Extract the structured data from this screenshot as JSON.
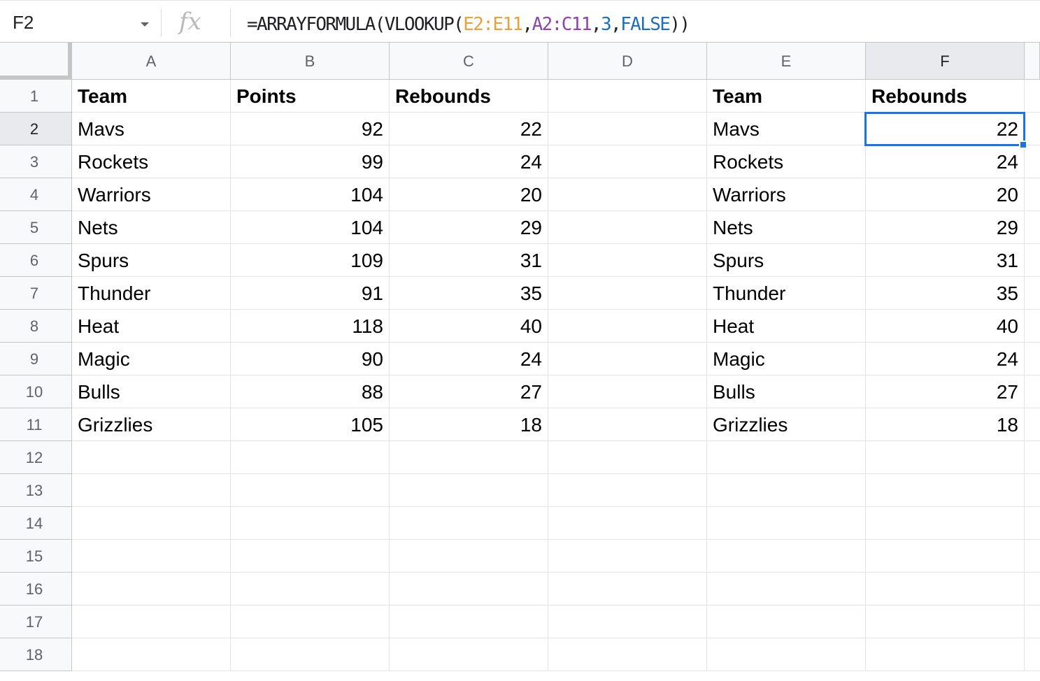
{
  "formula_bar": {
    "name_box": "F2",
    "fx_label": "fx",
    "formula_parts": {
      "prefix": "=ARRAYFORMULA(VLOOKUP(",
      "range1": "E2:E11",
      "comma1": ",",
      "range2": "A2:C11",
      "comma2": ",",
      "index": "3",
      "comma3": ",",
      "match_flag": "FALSE",
      "suffix": "))"
    }
  },
  "columns": [
    "A",
    "B",
    "C",
    "D",
    "E",
    "F"
  ],
  "selected_cell": "F2",
  "row_numbers": [
    "1",
    "2",
    "3",
    "4",
    "5",
    "6",
    "7",
    "8",
    "9",
    "10",
    "11",
    "12",
    "13",
    "14",
    "15",
    "16",
    "17",
    "18"
  ],
  "rows": [
    [
      "Team",
      "Points",
      "Rebounds",
      "",
      "Team",
      "Rebounds"
    ],
    [
      "Mavs",
      "92",
      "22",
      "",
      "Mavs",
      "22"
    ],
    [
      "Rockets",
      "99",
      "24",
      "",
      "Rockets",
      "24"
    ],
    [
      "Warriors",
      "104",
      "20",
      "",
      "Warriors",
      "20"
    ],
    [
      "Nets",
      "104",
      "29",
      "",
      "Nets",
      "29"
    ],
    [
      "Spurs",
      "109",
      "31",
      "",
      "Spurs",
      "31"
    ],
    [
      "Thunder",
      "91",
      "35",
      "",
      "Thunder",
      "35"
    ],
    [
      "Heat",
      "118",
      "40",
      "",
      "Heat",
      "40"
    ],
    [
      "Magic",
      "90",
      "24",
      "",
      "Magic",
      "24"
    ],
    [
      "Bulls",
      "88",
      "27",
      "",
      "Bulls",
      "27"
    ],
    [
      "Grizzlies",
      "105",
      "18",
      "",
      "Grizzlies",
      "18"
    ]
  ],
  "colors": {
    "selection": "#1a73e8",
    "range1": "#e8a23b",
    "range2": "#8e44ad",
    "literal": "#1f6fc1"
  }
}
